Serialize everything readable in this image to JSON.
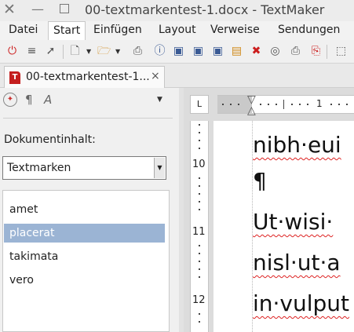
{
  "window": {
    "title": "00-textmarkentest-1.docx - TextMaker"
  },
  "menubar": [
    {
      "label": "Datei",
      "active": false
    },
    {
      "label": "Start",
      "active": true
    },
    {
      "label": "Einfügen",
      "active": false
    },
    {
      "label": "Layout",
      "active": false
    },
    {
      "label": "Verweise",
      "active": false
    },
    {
      "label": "Sendungen",
      "active": false
    }
  ],
  "toolbar": {
    "icons": [
      "power-icon",
      "hamburger-menu-icon",
      "pointer-icon",
      "new-document-icon",
      "open-folder-icon",
      "print-icon",
      "document-info-icon",
      "save-icon",
      "save-as-icon",
      "save-all-icon",
      "folder-tree-icon",
      "close-document-icon",
      "globe-icon",
      "print-preview-icon",
      "pdf-export-icon",
      "select-frame-icon"
    ]
  },
  "tab": {
    "label": "00-textmarkentest-1...",
    "close": "×",
    "icon_letter": "T"
  },
  "sidebar": {
    "tool_icons": [
      "navigator-icon",
      "paragraph-marks-icon",
      "character-style-icon",
      "chevron-down-icon"
    ],
    "content_label": "Dokumentinhalt:",
    "dropdown_value": "Textmarken",
    "bookmarks": [
      {
        "label": "amet",
        "selected": false
      },
      {
        "label": "placerat",
        "selected": true
      },
      {
        "label": "takimata",
        "selected": false
      },
      {
        "label": "vero",
        "selected": false
      }
    ]
  },
  "ruler": {
    "corner_symbol": "L",
    "h_label": "1",
    "v_labels": [
      "10",
      "11",
      "12"
    ]
  },
  "document": {
    "lines": [
      "nibh·eui",
      "¶",
      "Ut·wisi·",
      "nisl·ut·a",
      "in·vulput"
    ]
  }
}
